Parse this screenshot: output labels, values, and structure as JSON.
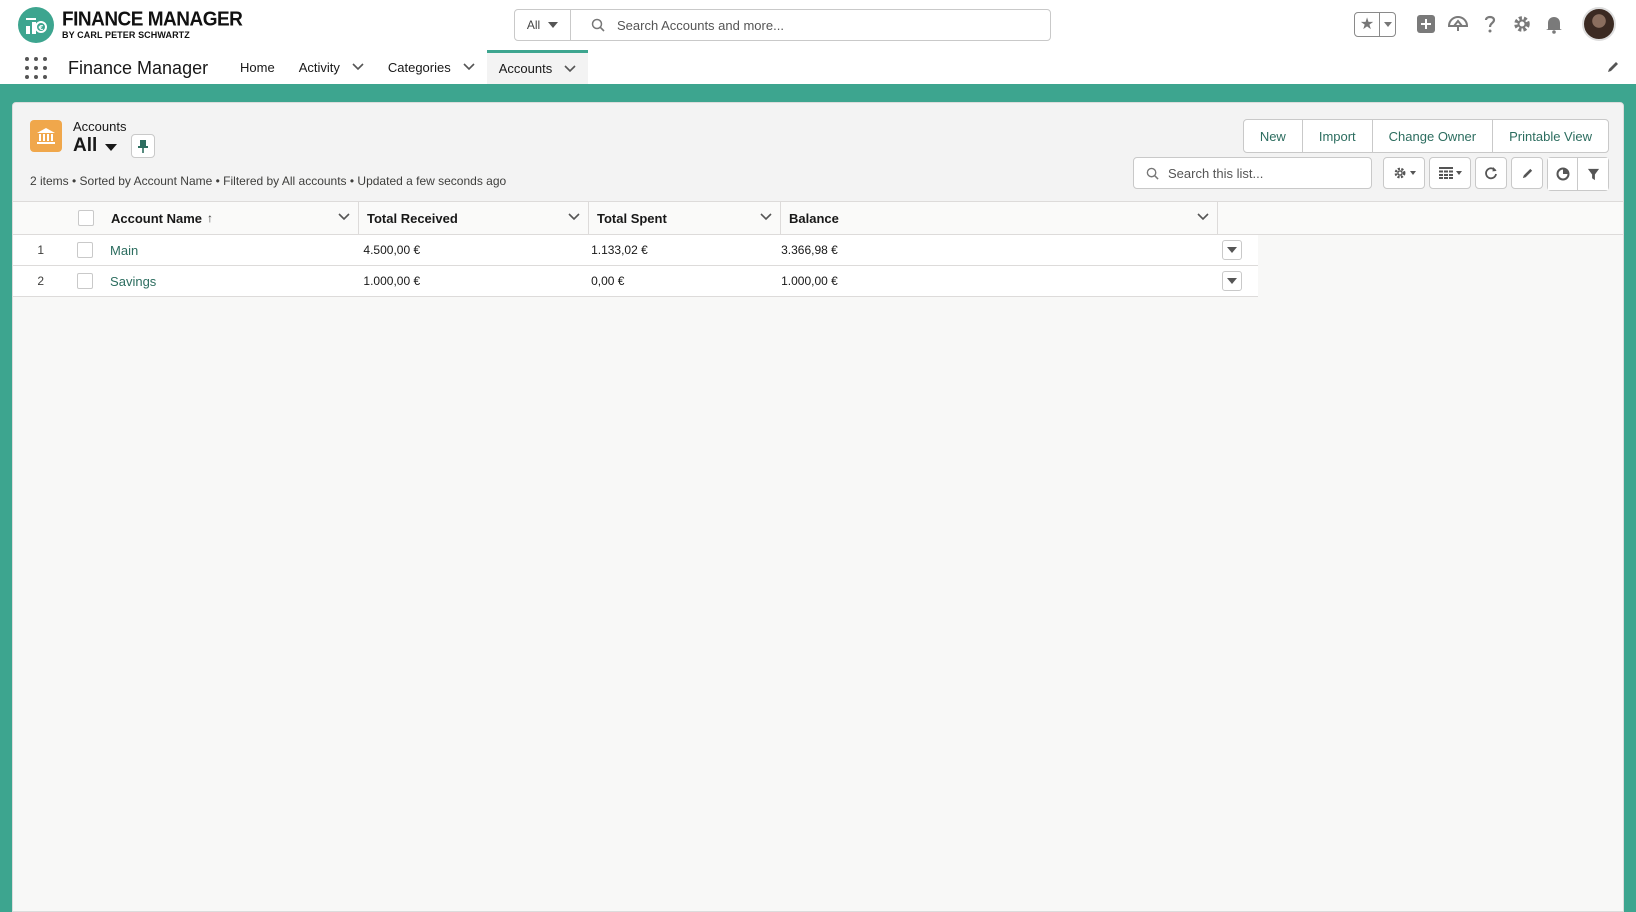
{
  "brand": {
    "title": "FINANCE MANAGER",
    "subtitle": "BY CARL PETER SCHWARTZ",
    "accent": "#3da58f"
  },
  "global_search": {
    "scope": "All",
    "placeholder": "Search Accounts and more..."
  },
  "header_icons": [
    "star-icon",
    "add-icon",
    "trailhead-icon",
    "help-icon",
    "setup-gear-icon",
    "notification-bell-icon",
    "user-avatar"
  ],
  "nav": {
    "app_name": "Finance Manager",
    "tabs": [
      {
        "label": "Home",
        "has_menu": false,
        "active": false
      },
      {
        "label": "Activity",
        "has_menu": true,
        "active": false
      },
      {
        "label": "Categories",
        "has_menu": true,
        "active": false
      },
      {
        "label": "Accounts",
        "has_menu": true,
        "active": true
      }
    ]
  },
  "list_view": {
    "object_label": "Accounts",
    "view_name": "All",
    "meta": "2 items • Sorted by Account Name • Filtered by All accounts • Updated a few seconds ago",
    "actions": [
      "New",
      "Import",
      "Change Owner",
      "Printable View"
    ],
    "search_placeholder": "Search this list...",
    "icon_color": "#f0a74b",
    "columns": [
      "Account Name",
      "Total Received",
      "Total Spent",
      "Balance"
    ],
    "sorted_column": "Account Name",
    "rows": [
      {
        "num": "1",
        "name": "Main",
        "received": "4.500,00 €",
        "spent": "1.133,02 €",
        "balance": "3.366,98 €"
      },
      {
        "num": "2",
        "name": "Savings",
        "received": "1.000,00 €",
        "spent": "0,00 €",
        "balance": "1.000,00 €"
      }
    ]
  }
}
